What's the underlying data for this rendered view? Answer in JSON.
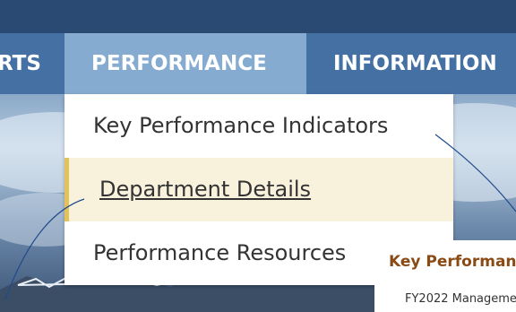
{
  "nav": {
    "items": [
      {
        "label": "RTS"
      },
      {
        "label": "PERFORMANCE"
      },
      {
        "label": "INFORMATION"
      }
    ]
  },
  "dropdown": {
    "items": [
      {
        "label": "Key Performance Indicators"
      },
      {
        "label": "Department Details"
      },
      {
        "label": "Performance Resources"
      }
    ]
  },
  "content": {
    "heading": "Key Performance",
    "subtext": "FY2022 Manageme"
  },
  "colors": {
    "top_bar": "#2a4a73",
    "nav": "#4470a4",
    "nav_active": "#86abd0",
    "highlight": "#f8f2dd",
    "highlight_border": "#e3c25a",
    "heading": "#8b4a14"
  }
}
